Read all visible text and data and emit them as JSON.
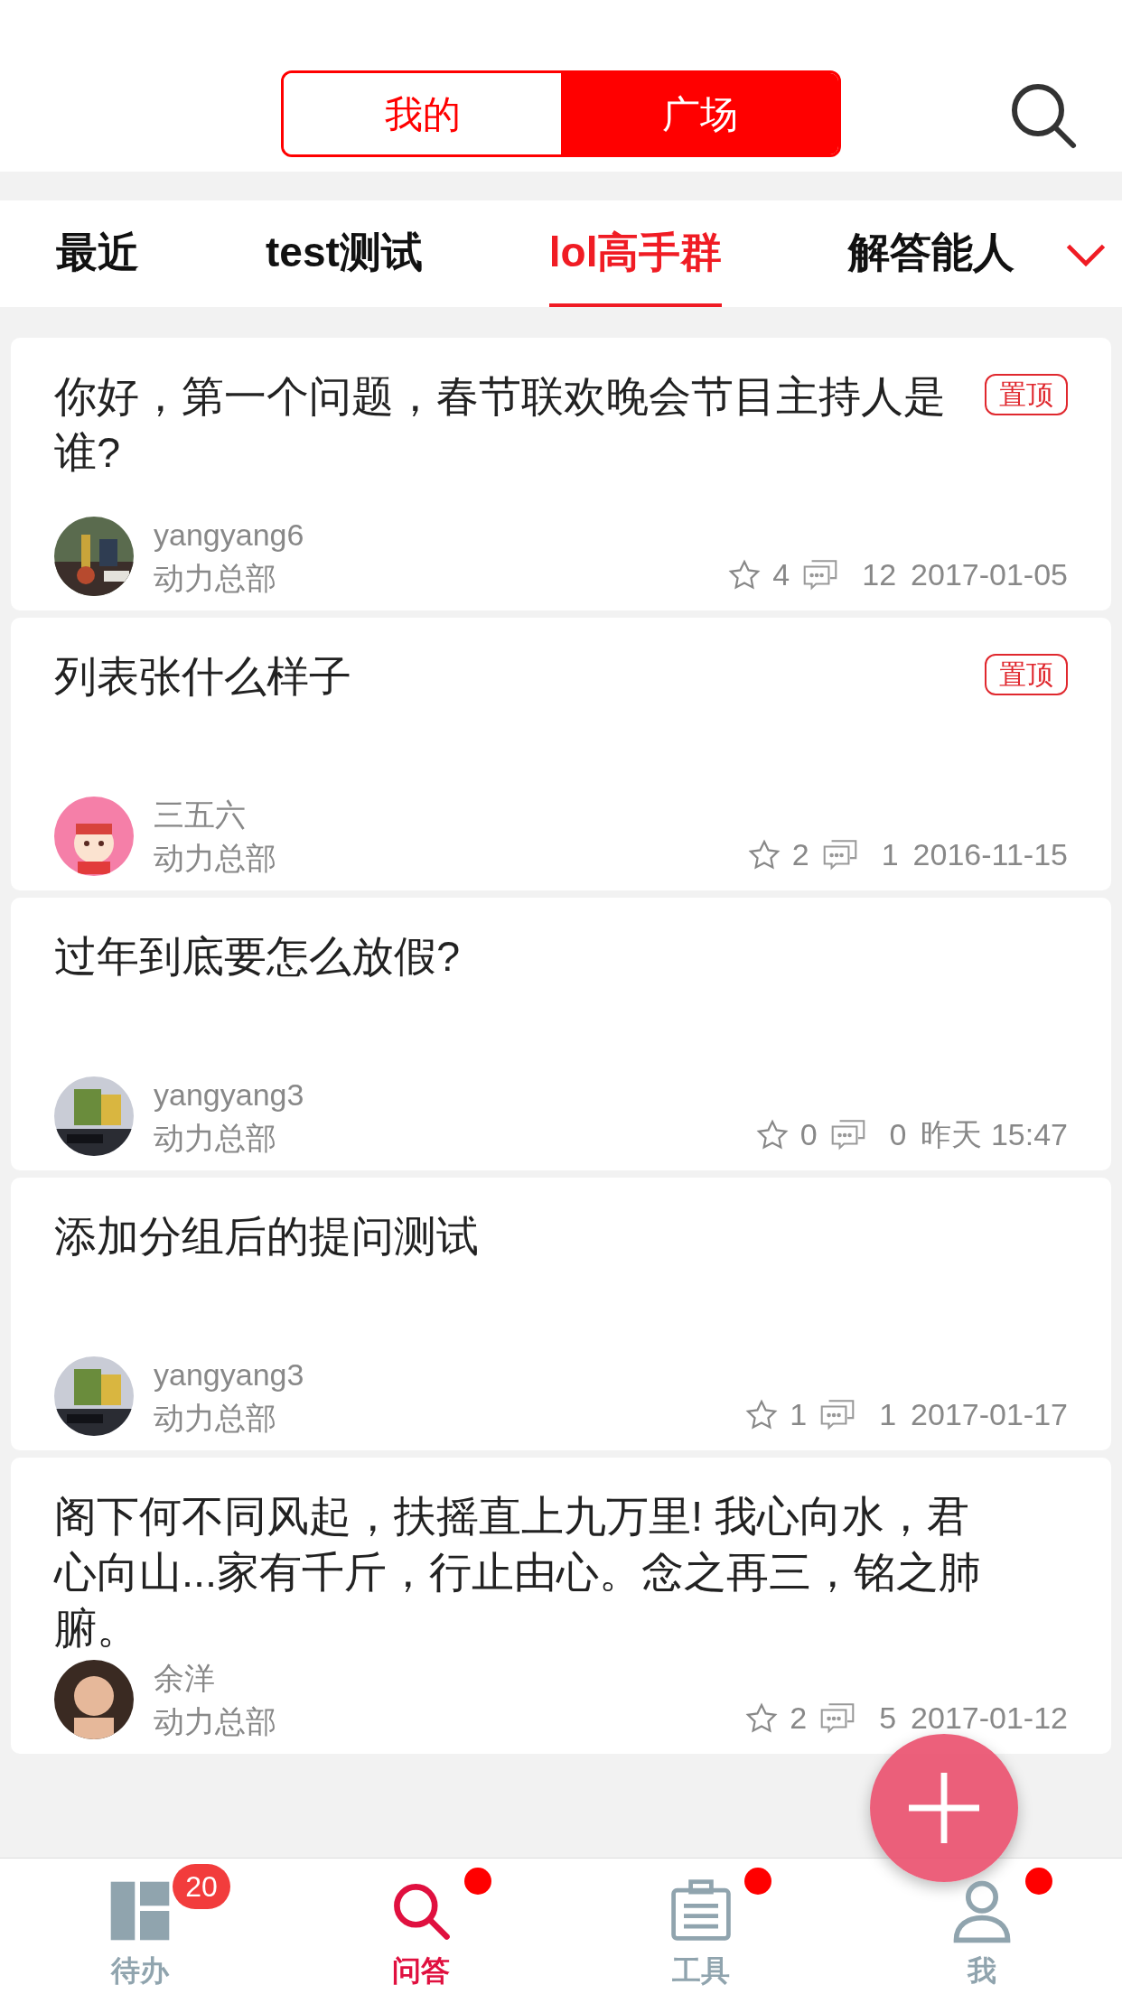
{
  "segments": [
    {
      "label": "我的",
      "selected": false
    },
    {
      "label": "广场",
      "selected": true
    }
  ],
  "tabs": [
    {
      "label": "最近",
      "selected": false
    },
    {
      "label": "test测试",
      "selected": false
    },
    {
      "label": "lol高手群",
      "selected": true
    },
    {
      "label": "解答能人",
      "selected": false
    }
  ],
  "questions": [
    {
      "title": "你好，第一个问题，春节联欢晚会节目主持人是谁?",
      "pinned": true,
      "pin_label": "置顶",
      "author": "yangyang6",
      "department": "动力总部",
      "stars": "4",
      "comments": "12",
      "date": "2017-01-05"
    },
    {
      "title": "列表张什么样子",
      "pinned": true,
      "pin_label": "置顶",
      "author": "三五六",
      "department": "动力总部",
      "stars": "2",
      "comments": "1",
      "date": "2016-11-15"
    },
    {
      "title": "过年到底要怎么放假?",
      "pinned": false,
      "author": "yangyang3",
      "department": "动力总部",
      "stars": "0",
      "comments": "0",
      "date": "昨天 15:47"
    },
    {
      "title": "添加分组后的提问测试",
      "pinned": false,
      "author": "yangyang3",
      "department": "动力总部",
      "stars": "1",
      "comments": "1",
      "date": "2017-01-17"
    },
    {
      "title": "阁下何不同风起，扶摇直上九万里! 我心向水，君心向山...家有千斤，行止由心。念之再三，铭之肺腑。",
      "pinned": false,
      "author": "余洋",
      "department": "动力总部",
      "stars": "2",
      "comments": "5",
      "date": "2017-01-12"
    }
  ],
  "nav": [
    {
      "label": "待办",
      "selected": false,
      "badge": "20",
      "dot": false
    },
    {
      "label": "问答",
      "selected": true,
      "dot": true
    },
    {
      "label": "工具",
      "selected": false,
      "dot": true
    },
    {
      "label": "我",
      "selected": false,
      "dot": true
    }
  ]
}
